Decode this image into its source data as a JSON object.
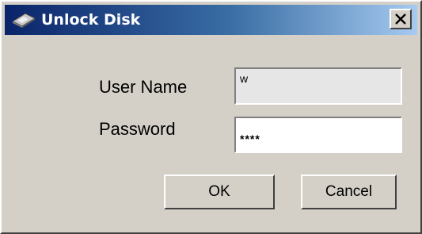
{
  "window": {
    "title": "Unlock Disk",
    "title_icon": "disk-icon",
    "close_icon": "close-icon",
    "colors": {
      "titlebar_start": "#0a246a",
      "titlebar_end": "#a6caf0",
      "face": "#d4d0c8"
    }
  },
  "form": {
    "username_label": "User Name",
    "username_value": "w",
    "password_label": "Password",
    "password_mask": "****"
  },
  "buttons": {
    "ok_label": "OK",
    "cancel_label": "Cancel"
  }
}
